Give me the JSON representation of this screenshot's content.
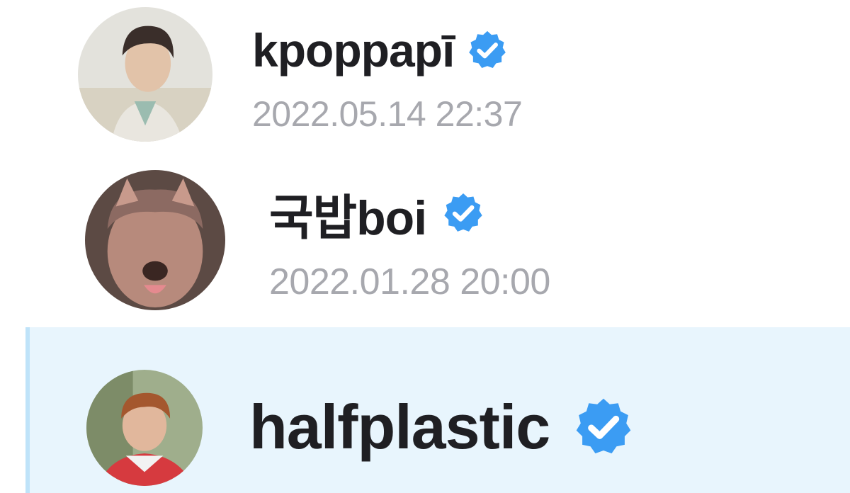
{
  "colors": {
    "name_text": "#1f1f23",
    "timestamp_text": "#a7a8ae",
    "verified_badge": "#3b9cf3",
    "highlight_background": "#e8f5fd",
    "highlight_border": "#bfe3f9"
  },
  "entries": [
    {
      "username": "kpoppapī",
      "verified": true,
      "badge_icon": "verified-badge-icon",
      "timestamp": "2022.05.14 22:37",
      "highlighted": false
    },
    {
      "username": "국밥boi",
      "verified": true,
      "badge_icon": "verified-badge-icon",
      "timestamp": "2022.01.28 20:00",
      "highlighted": false
    },
    {
      "username": "halfplastic",
      "verified": true,
      "badge_icon": "verified-badge-icon",
      "timestamp": "",
      "highlighted": true
    }
  ]
}
